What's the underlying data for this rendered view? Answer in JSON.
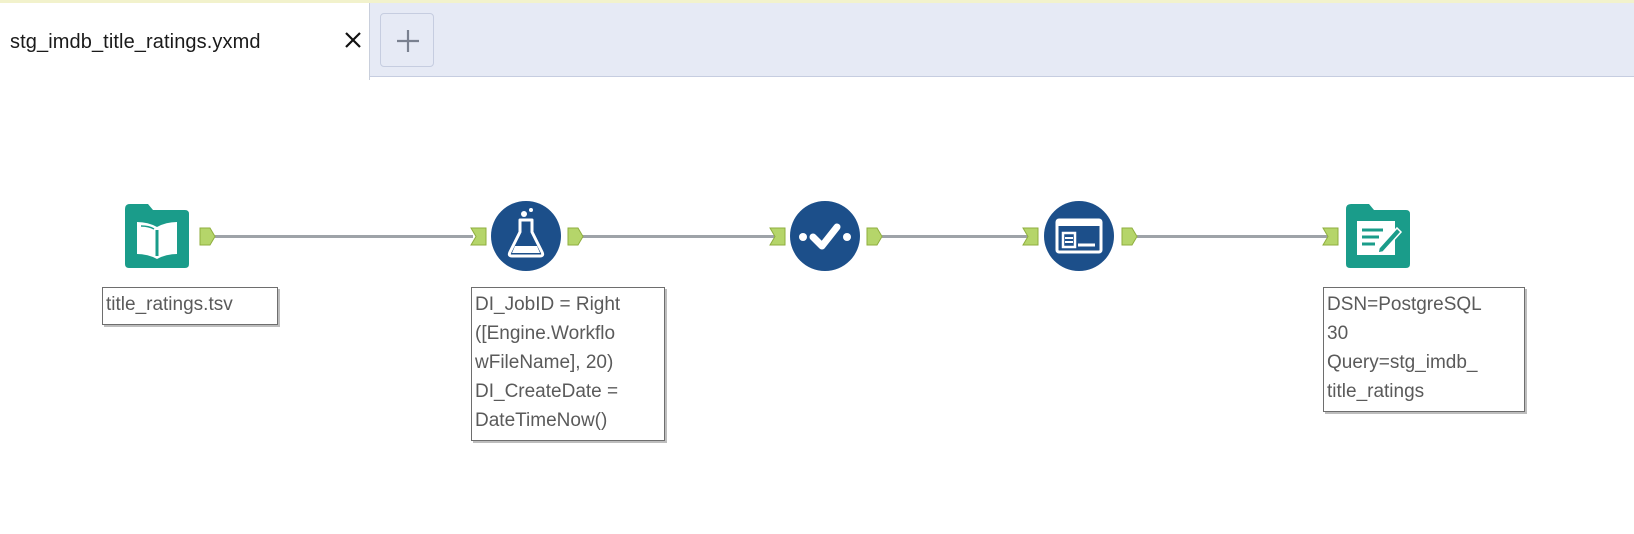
{
  "tabs": {
    "active_title": "stg_imdb_title_ratings.yxmd",
    "close_symbol": "✕",
    "add_symbol": "+"
  },
  "tools": {
    "input": {
      "icon": "book-icon",
      "color": "#1a9c8a",
      "annotation": "title_ratings.tsv"
    },
    "formula": {
      "icon": "flask-icon",
      "color": "#1c4f8a",
      "annotation": [
        "DI_JobID = Right",
        "([Engine.Workflo",
        "wFileName], 20)",
        "DI_CreateDate =",
        "DateTimeNow()"
      ]
    },
    "select": {
      "icon": "checkmark-icon",
      "color": "#1c4f8a"
    },
    "autofield": {
      "icon": "autofield-icon",
      "color": "#1c4f8a"
    },
    "output": {
      "icon": "notepad-pen-icon",
      "color": "#1a9c8a",
      "annotation": [
        "DSN=PostgreSQL",
        "30",
        "Query=stg_imdb_",
        "title_ratings"
      ]
    }
  },
  "colors": {
    "anchor": "#b5d56a",
    "connection": "#9ea3a8",
    "tab_bar": "#e6eaf5"
  }
}
